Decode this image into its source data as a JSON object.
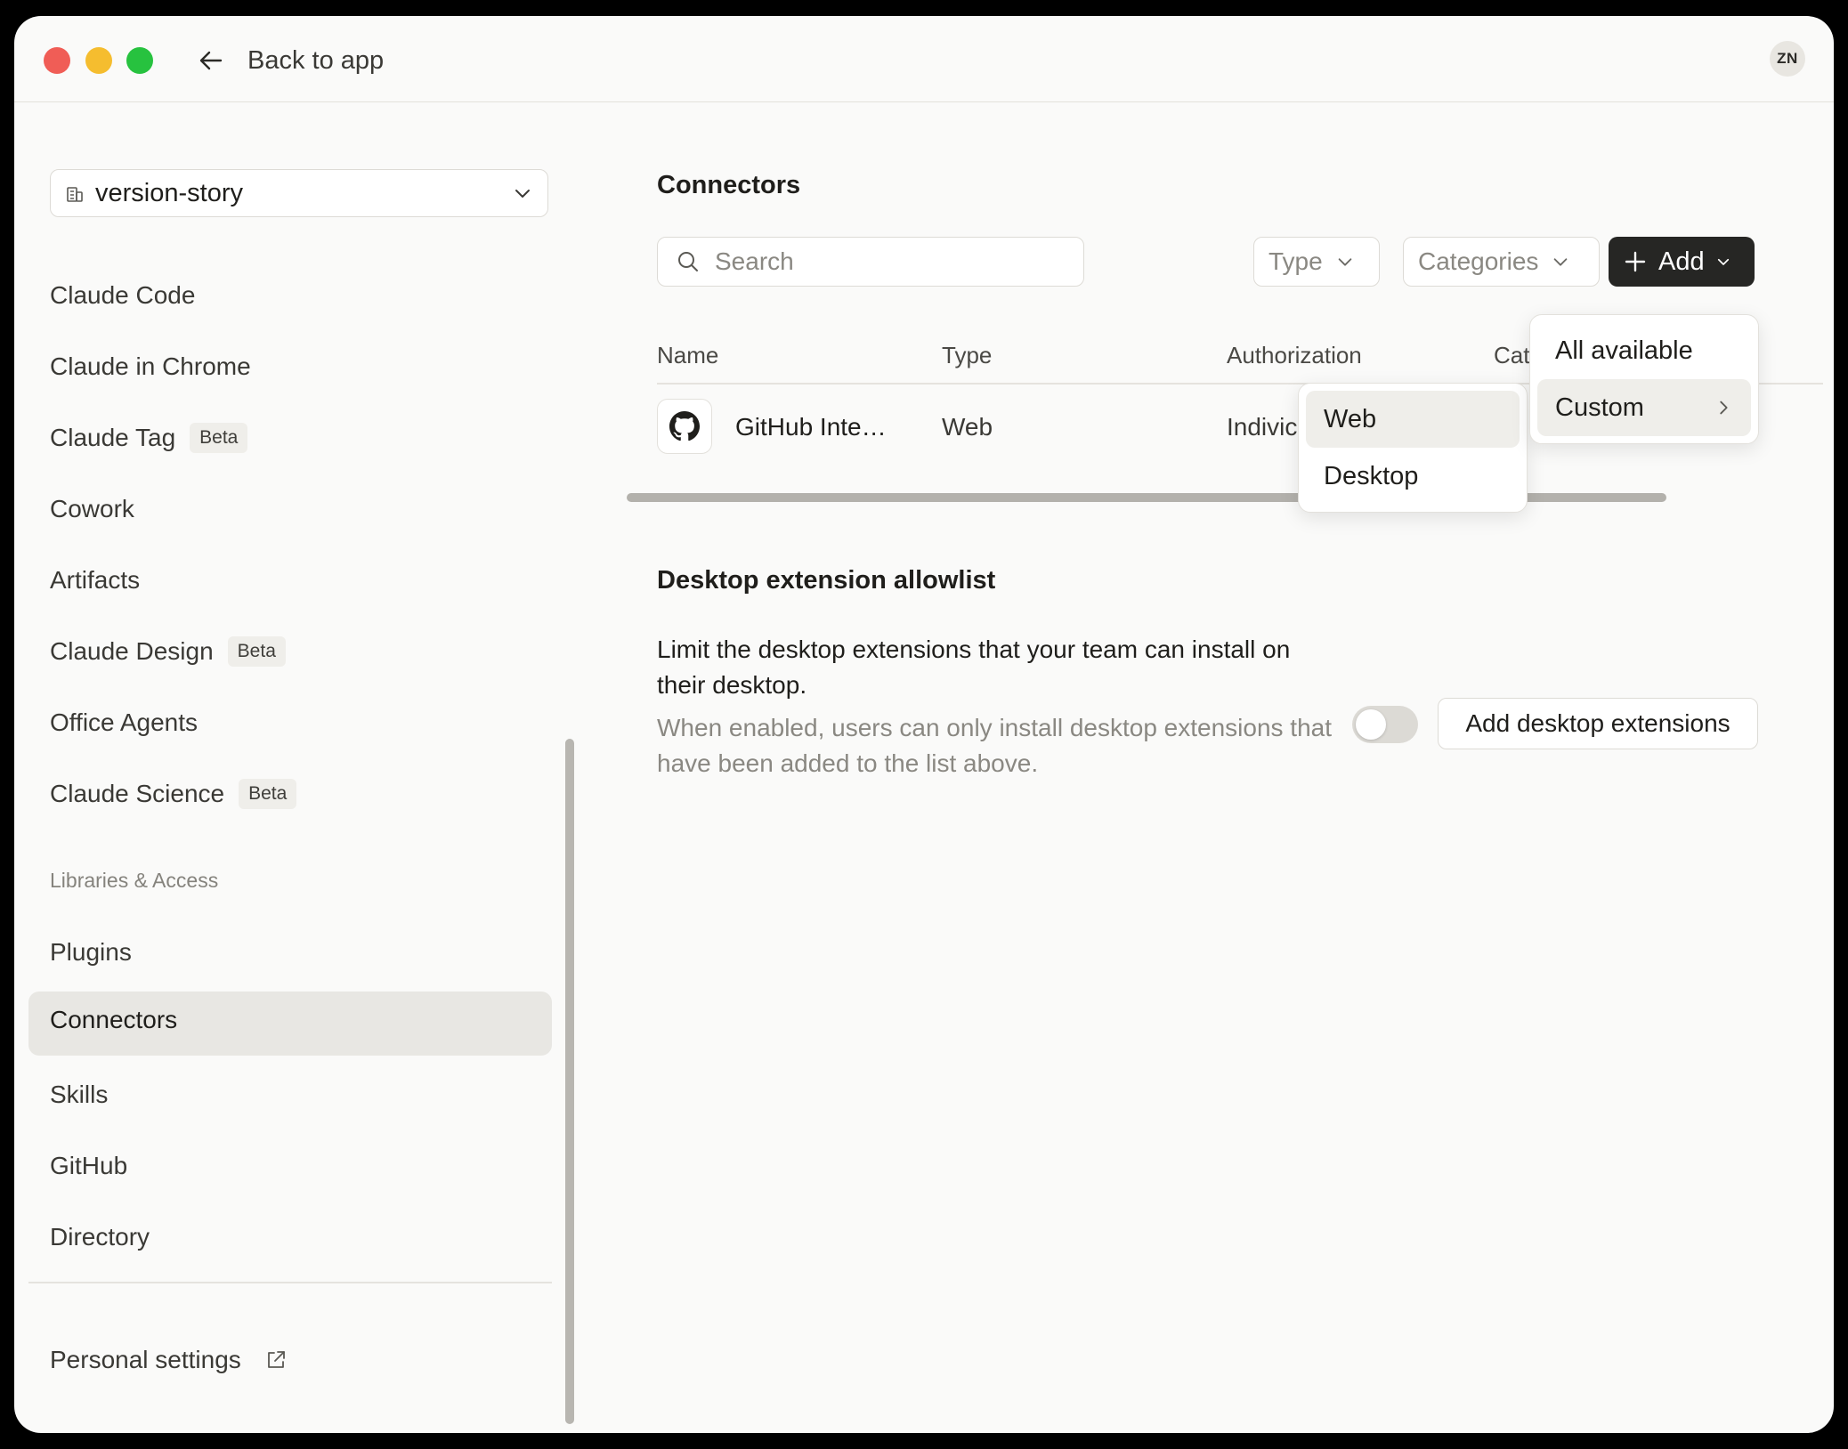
{
  "titlebar": {
    "back_label": "Back to app",
    "avatar_initials": "ZN"
  },
  "sidebar": {
    "workspace": "version-story",
    "items": [
      {
        "label": "Claude Code",
        "badge": ""
      },
      {
        "label": "Claude in Chrome",
        "badge": ""
      },
      {
        "label": "Claude Tag",
        "badge": "Beta"
      },
      {
        "label": "Cowork",
        "badge": ""
      },
      {
        "label": "Artifacts",
        "badge": ""
      },
      {
        "label": "Claude Design",
        "badge": "Beta"
      },
      {
        "label": "Office Agents",
        "badge": ""
      },
      {
        "label": "Claude Science",
        "badge": "Beta"
      }
    ],
    "section_label": "Libraries & Access",
    "library_items": [
      "Plugins",
      "Connectors",
      "Skills",
      "GitHub",
      "Directory"
    ],
    "active_item": "Connectors",
    "personal_settings": "Personal settings"
  },
  "main": {
    "connectors_title": "Connectors",
    "search_placeholder": "Search",
    "filter_type": "Type",
    "filter_categories": "Categories",
    "add_label": "Add",
    "columns": [
      "Name",
      "Type",
      "Authorization",
      "Cat"
    ],
    "rows": [
      {
        "name": "GitHub Inte…",
        "type": "Web",
        "authorization": "Indivic"
      }
    ],
    "allowlist_title": "Desktop extension allowlist",
    "allowlist_description": "Limit the desktop extensions that your team can install on their desktop.",
    "allowlist_subtext": "When enabled, users can only install desktop extensions that have been added to the list above.",
    "allowlist_enabled": false,
    "add_extensions_label": "Add desktop extensions"
  },
  "add_menu": {
    "items": [
      "All available",
      "Custom"
    ]
  },
  "custom_submenu": {
    "items": [
      "Web",
      "Desktop"
    ]
  },
  "colors": {
    "window_bg": "#fafaf9",
    "add_button_bg": "#262624",
    "active_nav_bg": "#e8e7e3",
    "traffic_red": "#f05d56",
    "traffic_yellow": "#f5bd2f",
    "traffic_green": "#27c23f"
  }
}
